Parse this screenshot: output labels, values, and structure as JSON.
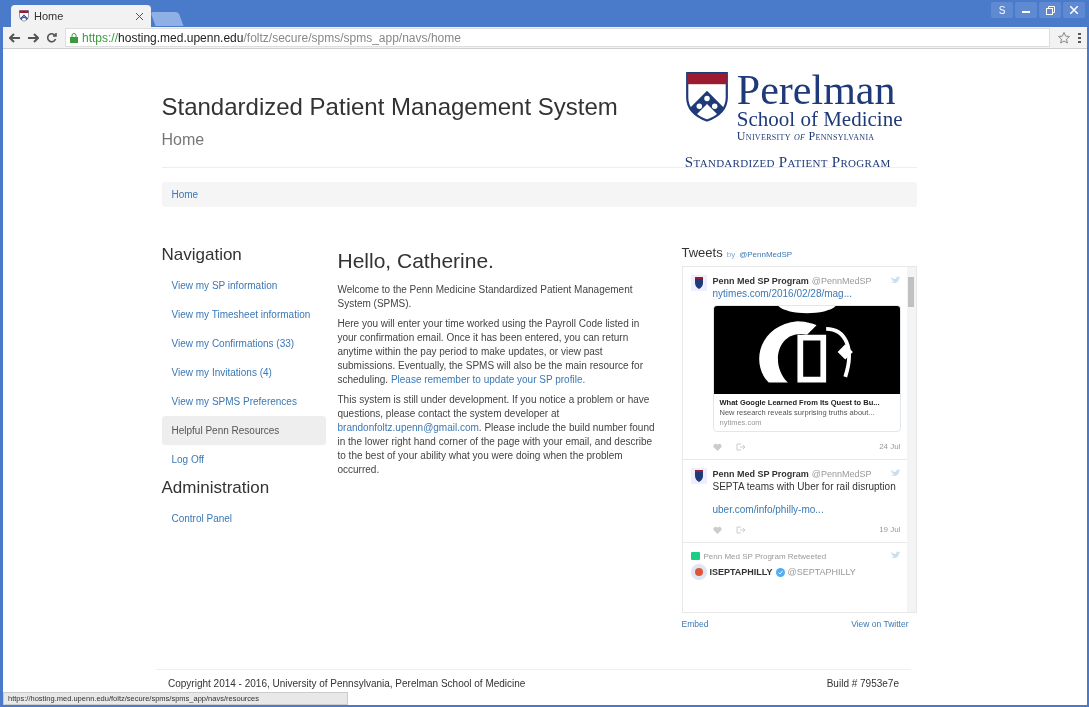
{
  "browser": {
    "tab_title": "Home",
    "url_scheme": "https://",
    "url_host": "hosting.med.upenn.edu",
    "url_path": "/foltz/secure/spms/spms_app/navs/home",
    "profile": "S",
    "status_url": "https://hosting.med.upenn.edu/foltz/secure/spms/spms_app/navs/resources"
  },
  "header": {
    "title": "Standardized Patient Management System",
    "subtitle": "Home",
    "logo_name": "Perelman",
    "logo_school": "School of Medicine",
    "logo_university": "University *of* Pennsylvania",
    "logo_program": "Standardized Patient Program"
  },
  "breadcrumb": [
    "Home"
  ],
  "sidebar": [
    {
      "heading": "Navigation",
      "items": [
        {
          "label": "View my SP information",
          "selected": false
        },
        {
          "label": "View my Timesheet information",
          "selected": false
        },
        {
          "label": "View my Confirmations (33)",
          "selected": false
        },
        {
          "label": "View my Invitations (4)",
          "selected": false
        },
        {
          "label": "View my SPMS Preferences",
          "selected": false
        },
        {
          "label": "Helpful Penn Resources",
          "selected": true
        },
        {
          "label": "Log Off",
          "selected": false
        }
      ]
    },
    {
      "heading": "Administration",
      "items": [
        {
          "label": "Control Panel",
          "selected": false
        }
      ]
    }
  ],
  "main": {
    "greeting": "Hello, Catherine.",
    "paragraphs": [
      [
        {
          "text": "Welcome to the Penn Medicine Standardized Patient Management System (SPMS).",
          "link": false
        }
      ],
      [
        {
          "text": "Here you will enter your time worked using the Payroll Code listed in your confirmation email. Once it has been entered, you can return anytime within the pay period to make updates, or view past submissions. Eventually, the SPMS will also be the main resource for scheduling.",
          "link": false
        },
        {
          "text": "Please remember to update your SP profile.",
          "link": true
        }
      ],
      [
        {
          "text": "This system is still under development. If you notice a problem or have questions, please contact the system developer at",
          "link": false
        },
        {
          "text": "brandonfoltz.upenn@gmail.com",
          "link": true
        },
        {
          "text": ". Please include the build number found in the lower right hand corner of the page with your email, and describe to the best of your ability what you were doing when the problem occurred.",
          "link": false
        }
      ]
    ]
  },
  "tweets": {
    "title": "Tweets",
    "by": "by",
    "handle": "@PennMedSP",
    "items": [
      {
        "kind": "card",
        "author": "Penn Med SP Program",
        "handle": "@PennMedSP",
        "link": "nytimes.com/2016/02/28/mag...",
        "card_title": "What Google Learned From Its Quest to Bu...",
        "card_text": "New research reveals surprising truths about...",
        "card_site": "nytimes.com",
        "date": "24 Jul"
      },
      {
        "kind": "text",
        "author": "Penn Med SP Program",
        "handle": "@PennMedSP",
        "text": "SEPTA teams with Uber for rail disruption",
        "link": "uber.com/info/philly-mo...",
        "date": "19 Jul"
      },
      {
        "kind": "retweet",
        "retweeted_by": "Penn Med SP Program Retweeted",
        "author": "ISEPTAPHILLY",
        "handle": "@SEPTAPHILLY",
        "verified": true
      }
    ],
    "embed": "Embed",
    "view": "View on Twitter"
  },
  "footer": {
    "copyright": "Copyright 2014 - 2016, University of Pennsylvania, Perelman School of Medicine",
    "build": "Build # 7953e7e"
  }
}
